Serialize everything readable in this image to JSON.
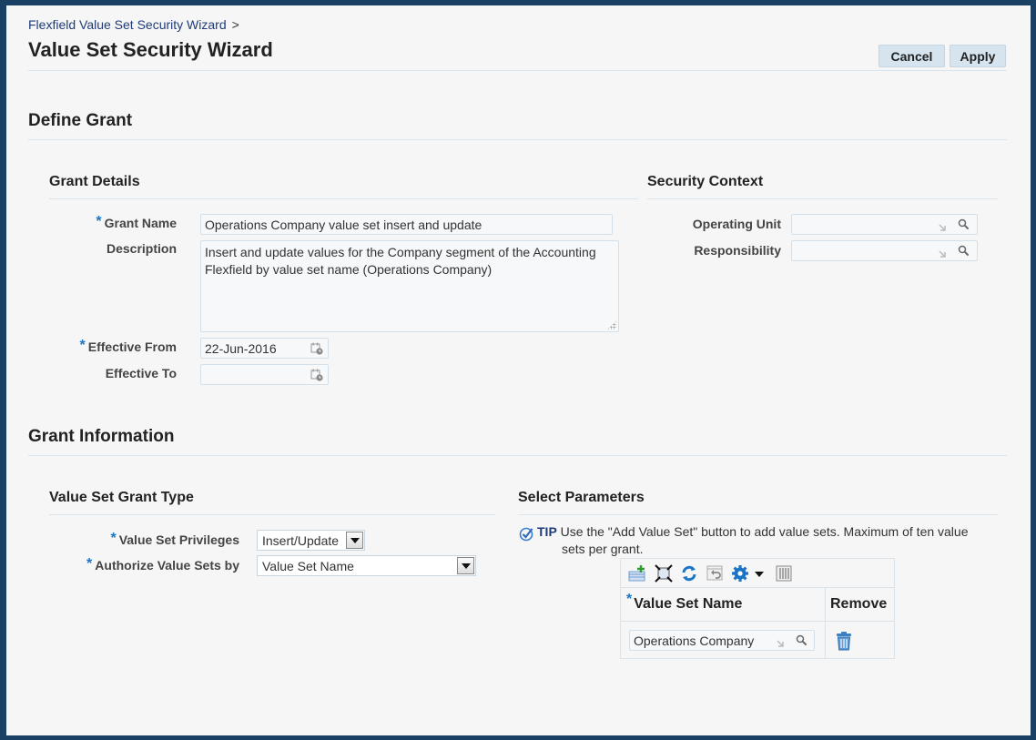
{
  "breadcrumb": {
    "link": "Flexfield Value Set Security Wizard",
    "separator": ">"
  },
  "page_title": "Value Set Security Wizard",
  "buttons": {
    "cancel": "Cancel",
    "apply": "Apply"
  },
  "define_grant": {
    "heading": "Define Grant",
    "grant_details": {
      "heading": "Grant Details",
      "required_marker": "*",
      "grant_name_label": "Grant Name",
      "grant_name_value": "Operations Company value set insert and update",
      "description_label": "Description",
      "description_value": "Insert and update values for the Company segment of the Accounting Flexfield by value set name (Operations Company)",
      "effective_from_label": "Effective From",
      "effective_from_value": "22-Jun-2016",
      "effective_to_label": "Effective To",
      "effective_to_value": ""
    },
    "security_context": {
      "heading": "Security Context",
      "operating_unit_label": "Operating Unit",
      "operating_unit_value": "",
      "responsibility_label": "Responsibility",
      "responsibility_value": ""
    }
  },
  "grant_information": {
    "heading": "Grant Information",
    "grant_type": {
      "heading": "Value Set Grant Type",
      "required_marker": "*",
      "privileges_label": "Value Set Privileges",
      "privileges_value": "Insert/Update",
      "authorize_label": "Authorize Value Sets by",
      "authorize_value": "Value Set Name"
    },
    "select_parameters": {
      "heading": "Select Parameters",
      "tip_label": "TIP",
      "tip_text_line1": "Use the \"Add Value Set\" button to add value sets. Maximum of ten value",
      "tip_text_line2": "sets per grant.",
      "toolbar_icons": [
        "add-row-icon",
        "detach-icon",
        "refresh-icon",
        "revert-icon",
        "settings-icon",
        "dropdown-icon",
        "columns-icon"
      ],
      "table": {
        "required_marker": "*",
        "columns": [
          "Value Set Name",
          "Remove"
        ],
        "rows": [
          {
            "value_set_name": "Operations Company"
          }
        ]
      }
    }
  },
  "colors": {
    "frame": "#1a4163",
    "background": "#f6f6f6",
    "link": "#1f3b78",
    "required": "#1a75c7",
    "button": "#d5e4ee"
  }
}
